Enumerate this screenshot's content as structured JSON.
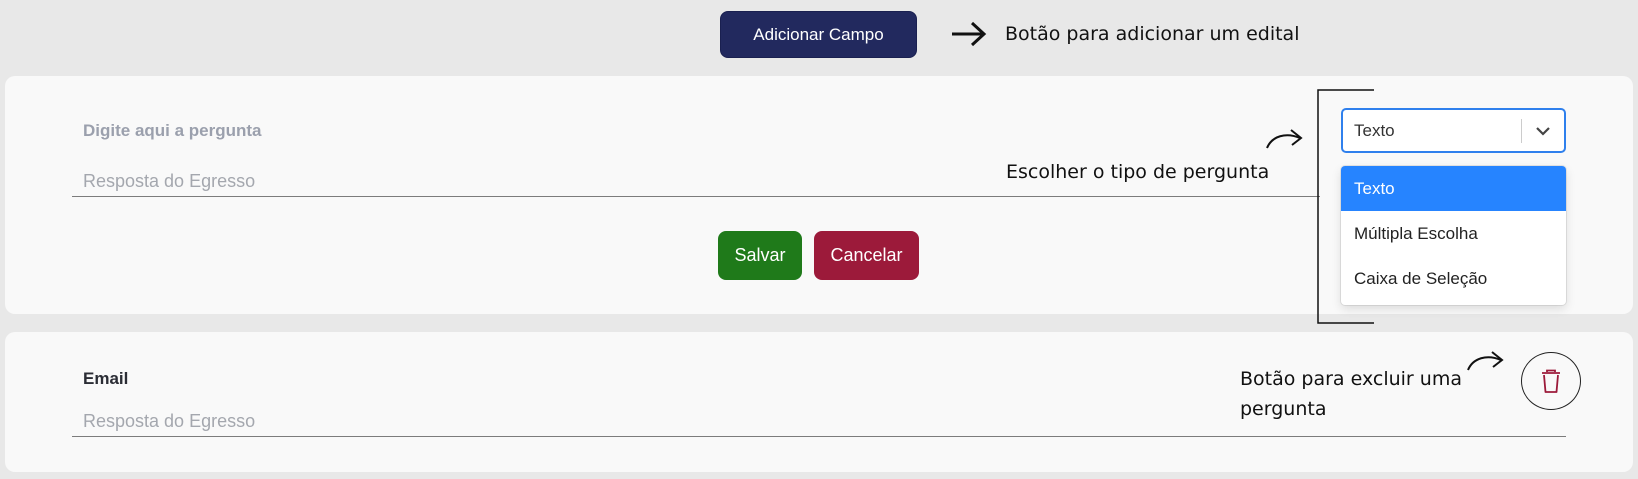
{
  "toolbar": {
    "add_field_label": "Adicionar Campo"
  },
  "annotations": {
    "add_field": "Botão para adicionar um edital",
    "choose_type": "Escolher o tipo de pergunta",
    "delete_line1": "Botão para excluir uma",
    "delete_line2": "pergunta"
  },
  "new_question": {
    "placeholder_question": "Digite aqui a pergunta",
    "answer_placeholder": "Resposta do Egresso",
    "save_label": "Salvar",
    "cancel_label": "Cancelar",
    "type_select": {
      "value": "Texto",
      "options": [
        {
          "label": "Texto",
          "selected": true
        },
        {
          "label": "Múltipla Escolha",
          "selected": false
        },
        {
          "label": "Caixa de Seleção",
          "selected": false
        }
      ]
    }
  },
  "existing_question": {
    "question": "Email",
    "answer_placeholder": "Resposta do Egresso"
  },
  "icons": {
    "arrow": "arrow-right-icon",
    "chevron": "chevron-down-icon",
    "trash": "trash-icon"
  },
  "colors": {
    "add_button": "#22295e",
    "save_button": "#1f7a1a",
    "cancel_button": "#9c1a3a",
    "select_accent": "#2f80ed",
    "selected_option": "#2684ff",
    "trash_icon": "#9c1a3a"
  }
}
